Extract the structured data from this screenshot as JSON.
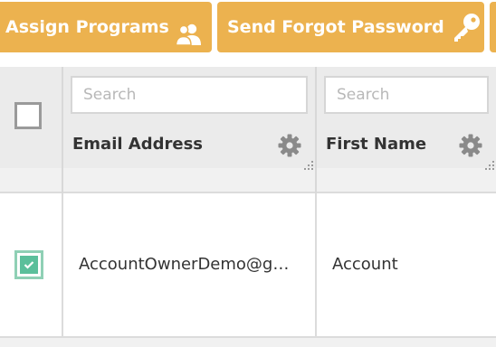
{
  "toolbar": {
    "assign_programs_label": "Assign Programs",
    "assign_programs_icon": "users-icon",
    "send_forgot_password_label": "Send Forgot Password",
    "send_forgot_password_icon": "key-icon",
    "accent_color": "#ecb24f"
  },
  "table": {
    "columns": [
      {
        "title": "Email Address",
        "search_placeholder": "Search",
        "settings_icon": "gear-icon"
      },
      {
        "title": "First Name",
        "search_placeholder": "Search",
        "settings_icon": "gear-icon"
      }
    ],
    "header_checkbox_checked": false,
    "rows": [
      {
        "selected": true,
        "email": "AccountOwnerDemo@g…",
        "first_name": "Account"
      }
    ],
    "selected_color": "#5bbf9b"
  }
}
